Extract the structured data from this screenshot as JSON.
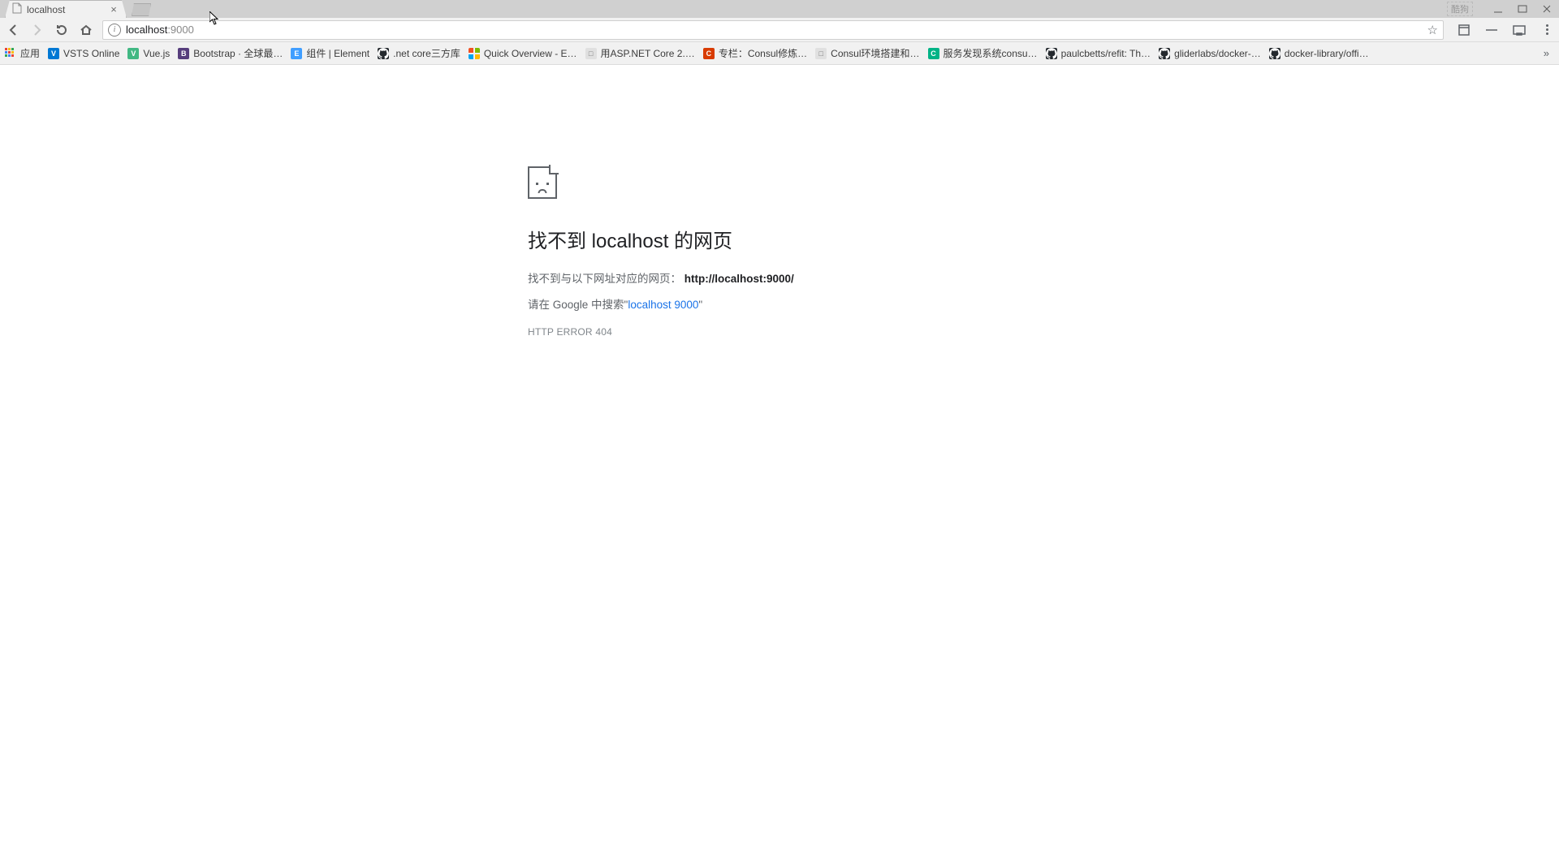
{
  "tab": {
    "title": "localhost"
  },
  "window": {
    "ext_badge": "酷狗"
  },
  "address": {
    "host": "localhost",
    "rest": ":9000"
  },
  "bookmarks": {
    "apps_label": "应用",
    "items": [
      {
        "label": "VSTS Online",
        "icon": "ic-vsts",
        "glyph": "V"
      },
      {
        "label": "Vue.js",
        "icon": "ic-vue",
        "glyph": "V"
      },
      {
        "label": "Bootstrap · 全球最…",
        "icon": "ic-boot",
        "glyph": "B"
      },
      {
        "label": "组件 | Element",
        "icon": "ic-elem",
        "glyph": "E"
      },
      {
        "label": ".net core三方库",
        "icon": "ic-gh",
        "glyph": ""
      },
      {
        "label": "Quick Overview - E…",
        "icon": "ic-ms",
        "glyph": ""
      },
      {
        "label": "用ASP.NET Core 2.…",
        "icon": "ic-file",
        "glyph": "□"
      },
      {
        "label": "专栏：Consul修炼…",
        "icon": "ic-csdn",
        "glyph": "C"
      },
      {
        "label": "Consul环境搭建和…",
        "icon": "ic-file",
        "glyph": "□"
      },
      {
        "label": "服务发现系统consu…",
        "icon": "ic-consul",
        "glyph": "C"
      },
      {
        "label": "paulcbetts/refit: Th…",
        "icon": "ic-gh",
        "glyph": ""
      },
      {
        "label": "gliderlabs/docker-…",
        "icon": "ic-gh",
        "glyph": ""
      },
      {
        "label": "docker-library/offi…",
        "icon": "ic-gh",
        "glyph": ""
      }
    ]
  },
  "error": {
    "title": "找不到 localhost 的网页",
    "line1_prefix": "找不到与以下网址对应的网页：",
    "line1_url": "http://localhost:9000/",
    "line2_prefix": "请在 Google 中搜索\"",
    "line2_link": "localhost 9000",
    "line2_suffix": "\"",
    "code": "HTTP ERROR 404"
  }
}
